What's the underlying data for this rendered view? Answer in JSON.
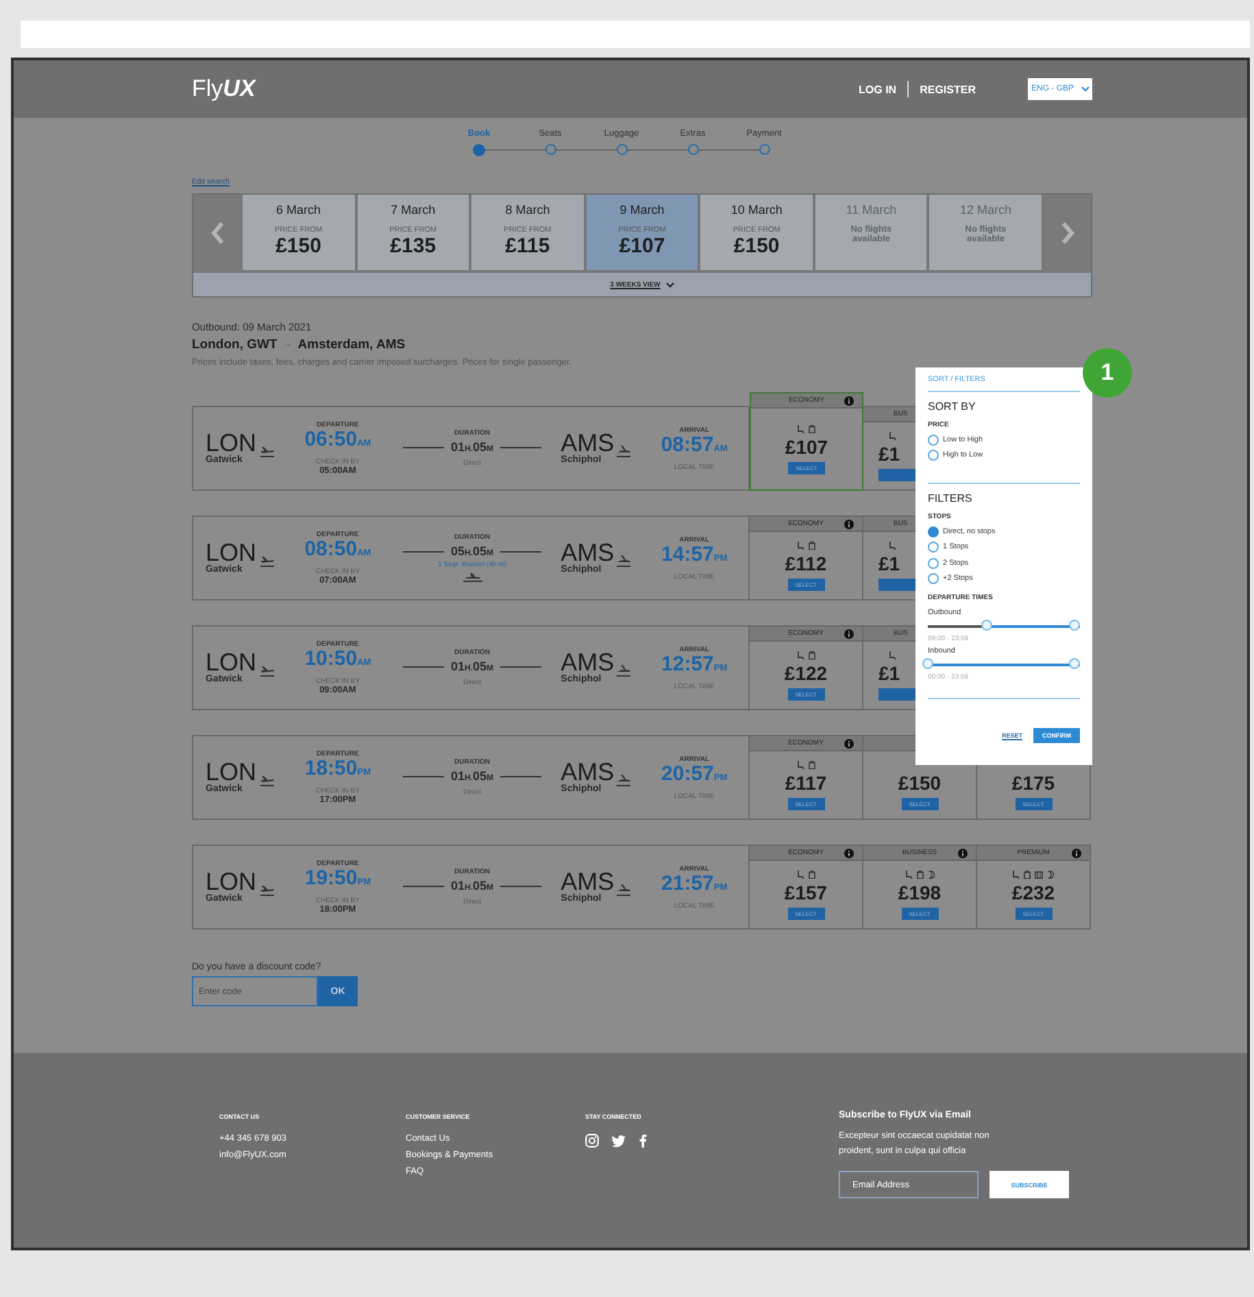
{
  "header": {
    "logo_plain": "Fly",
    "logo_bold": "UX",
    "links": [
      "LOG IN",
      "REGISTER"
    ],
    "language": "ENG - GBP"
  },
  "steps": [
    {
      "label": "Book",
      "selected": true
    },
    {
      "label": "Seats",
      "selected": false
    },
    {
      "label": "Luggage",
      "selected": false
    },
    {
      "label": "Extras",
      "selected": false
    },
    {
      "label": "Payment",
      "selected": false
    }
  ],
  "edit_search": "Edit search",
  "dates": [
    {
      "date": "6 March",
      "available": true,
      "selected": false,
      "caption": "PRICE FROM",
      "price": "£150"
    },
    {
      "date": "7 March",
      "available": true,
      "selected": false,
      "caption": "PRICE FROM",
      "price": "£135"
    },
    {
      "date": "8 March",
      "available": true,
      "selected": false,
      "caption": "PRICE FROM",
      "price": "£115"
    },
    {
      "date": "9 March",
      "available": true,
      "selected": true,
      "caption": "PRICE FROM",
      "price": "£107"
    },
    {
      "date": "10 March",
      "available": true,
      "selected": false,
      "caption": "PRICE FROM",
      "price": "£150"
    },
    {
      "date": "11 March",
      "available": false,
      "selected": false,
      "caption": "No flights available"
    },
    {
      "date": "12 March",
      "available": false,
      "selected": false,
      "caption": "No flights available"
    }
  ],
  "weeks_view": "3 WEEKS VIEW",
  "outbound": "Outbound: 09 March 2021",
  "route": {
    "from": "London, GWT",
    "arrow": "→",
    "to": "Amsterdam, AMS"
  },
  "note": "Prices include taxes, fees, charges and carrier imposed surcharges. Prices for single passenger.",
  "flights": [
    {
      "from": "LON",
      "from_airport": "Gatwick",
      "dep_label": "DEPARTURE",
      "dep_time": "06:50",
      "dep_period": "AM",
      "checkin_label": "CHECK IN BY",
      "checkin": "05:00AM",
      "dur_label": "DURATION",
      "duration": [
        {
          "value": "01",
          "unit": "H."
        },
        {
          "value": "05",
          "unit": "M"
        }
      ],
      "stops": "Direct",
      "stopover": false,
      "to": "AMS",
      "to_airport": "Schiphol",
      "arr_label": "ARRIVAL",
      "arr_time": "08:57",
      "arr_period": "AM",
      "local": "LOCAL TIME",
      "fares": [
        {
          "class": "ECONOMY",
          "amenities": [
            {
              "kind": "seat"
            },
            {
              "kind": "bag"
            }
          ],
          "price": "£107",
          "button": "SELECT",
          "selected": true,
          "clipped": false
        },
        {
          "class": "BUS",
          "amenities": [
            {
              "kind": "seat"
            }
          ],
          "price": "£1",
          "selected": false,
          "clipped": true
        }
      ]
    },
    {
      "from": "LON",
      "from_airport": "Gatwick",
      "dep_label": "DEPARTURE",
      "dep_time": "08:50",
      "dep_period": "AM",
      "checkin_label": "CHECK IN BY",
      "checkin": "07:00AM",
      "dur_label": "DURATION",
      "duration": [
        {
          "value": "05",
          "unit": "H."
        },
        {
          "value": "05",
          "unit": "M"
        }
      ],
      "stops": "1 Stop: Brussel (4h m)",
      "stopover": true,
      "to": "AMS",
      "to_airport": "Schiphol",
      "arr_label": "ARRIVAL",
      "arr_time": "14:57",
      "arr_period": "PM",
      "local": "LOCAL TIME",
      "fares": [
        {
          "class": "ECONOMY",
          "amenities": [
            {
              "kind": "seat"
            },
            {
              "kind": "bag"
            }
          ],
          "price": "£112",
          "button": "SELECT",
          "selected": false,
          "clipped": false
        },
        {
          "class": "BUS",
          "amenities": [
            {
              "kind": "seat"
            }
          ],
          "price": "£1",
          "selected": false,
          "clipped": true
        }
      ]
    },
    {
      "from": "LON",
      "from_airport": "Gatwick",
      "dep_label": "DEPARTURE",
      "dep_time": "10:50",
      "dep_period": "AM",
      "checkin_label": "CHECK IN BY",
      "checkin": "09:00AM",
      "dur_label": "DURATION",
      "duration": [
        {
          "value": "01",
          "unit": "H."
        },
        {
          "value": "05",
          "unit": "M"
        }
      ],
      "stops": "Direct",
      "stopover": false,
      "to": "AMS",
      "to_airport": "Schiphol",
      "arr_label": "ARRIVAL",
      "arr_time": "12:57",
      "arr_period": "PM",
      "local": "LOCAL TIME",
      "fares": [
        {
          "class": "ECONOMY",
          "amenities": [
            {
              "kind": "seat"
            },
            {
              "kind": "bag"
            }
          ],
          "price": "£122",
          "button": "SELECT",
          "selected": false,
          "clipped": false
        },
        {
          "class": "BUS",
          "amenities": [
            {
              "kind": "seat"
            }
          ],
          "price": "£1",
          "selected": false,
          "clipped": true
        }
      ]
    },
    {
      "from": "LON",
      "from_airport": "Gatwick",
      "dep_label": "DEPARTURE",
      "dep_time": "18:50",
      "dep_period": "PM",
      "checkin_label": "CHECK IN BY",
      "checkin": "17:00PM",
      "dur_label": "DURATION",
      "duration": [
        {
          "value": "01",
          "unit": "H."
        },
        {
          "value": "05",
          "unit": "M"
        }
      ],
      "stops": "Direct",
      "stopover": false,
      "to": "AMS",
      "to_airport": "Schiphol",
      "arr_label": "ARRIVAL",
      "arr_time": "20:57",
      "arr_period": "PM",
      "local": "LOCAL TIME",
      "fares": [
        {
          "class": "ECONOMY",
          "amenities": [
            {
              "kind": "seat"
            },
            {
              "kind": "bag"
            }
          ],
          "price": "£117",
          "button": "SELECT",
          "selected": false,
          "clipped": false
        },
        {
          "price": "£150",
          "button": "SELECT",
          "selected": false,
          "clipped": false
        },
        {
          "price": "£175",
          "button": "SELECT",
          "selected": false,
          "clipped": false
        }
      ]
    },
    {
      "from": "LON",
      "from_airport": "Gatwick",
      "dep_label": "DEPARTURE",
      "dep_time": "19:50",
      "dep_period": "PM",
      "checkin_label": "CHECK IN BY",
      "checkin": "18:00PM",
      "dur_label": "DURATION",
      "duration": [
        {
          "value": "01",
          "unit": "H."
        },
        {
          "value": "05",
          "unit": "M"
        }
      ],
      "stops": "Direct",
      "stopover": false,
      "to": "AMS",
      "to_airport": "Schiphol",
      "arr_label": "ARRIVAL",
      "arr_time": "21:57",
      "arr_period": "PM",
      "local": "LOCAL TIME",
      "fares": [
        {
          "class": "ECONOMY",
          "amenities": [
            {
              "kind": "seat"
            },
            {
              "kind": "bag"
            }
          ],
          "price": "£157",
          "button": "SELECT",
          "selected": false,
          "clipped": false
        },
        {
          "class": "BUSINESS",
          "amenities": [
            {
              "kind": "seat"
            },
            {
              "kind": "bag"
            },
            {
              "kind": "meal"
            }
          ],
          "price": "£198",
          "button": "SELECT",
          "selected": false,
          "clipped": false
        },
        {
          "class": "PREMIUM",
          "amenities": [
            {
              "kind": "seat"
            },
            {
              "kind": "bag"
            },
            {
              "kind": "luggage"
            },
            {
              "kind": "meal"
            }
          ],
          "price": "£232",
          "button": "SELECT",
          "selected": false,
          "clipped": false
        }
      ]
    }
  ],
  "discount": {
    "question": "Do you have a discount code?",
    "placeholder": "Enter code",
    "button": "OK"
  },
  "panel": {
    "title": "SORT / FILTERS",
    "sort_heading": "SORT BY",
    "price_label": "PRICE",
    "price_options": [
      {
        "label": "Low to High",
        "selected": false
      },
      {
        "label": "High to Low",
        "selected": false
      }
    ],
    "filters_heading": "FILTERS",
    "stops_label": "STOPS",
    "stop_options": [
      {
        "label": "Direct, no stops",
        "selected": true
      },
      {
        "label": "1 Stops",
        "selected": false
      },
      {
        "label": "2 Stops",
        "selected": false
      },
      {
        "label": "+2 Stops",
        "selected": false
      }
    ],
    "times_label": "DEPARTURE TIMES",
    "sliders": [
      {
        "label": "Outbound",
        "level": 0.39,
        "reading": "09:00 - 23:59"
      },
      {
        "label": "Inbound",
        "level": 0,
        "reading": "00:00 - 23:59"
      }
    ],
    "reset": "RESET",
    "confirm": "CONFIRM"
  },
  "badge": "1",
  "footer": {
    "contact": {
      "heading": "CONTACT US",
      "lines": [
        "+44 345 678 903",
        "info@FlyUX.com"
      ]
    },
    "service": {
      "heading": "CUSTOMER SERVICE",
      "links": [
        "Contact Us",
        "Bookings & Payments",
        "FAQ"
      ]
    },
    "social": {
      "heading": "STAY CONNECTED",
      "networks": [
        {
          "kind": "instagram"
        },
        {
          "kind": "twitter"
        },
        {
          "kind": "facebook"
        }
      ]
    },
    "subscribe": {
      "heading": "Subscribe to FlyUX via Email",
      "text": "Excepteur sint occaecat cupidatat non proident, sunt in culpa qui officia",
      "placeholder": "Email Address",
      "button": "SUBSCRIBE"
    }
  }
}
